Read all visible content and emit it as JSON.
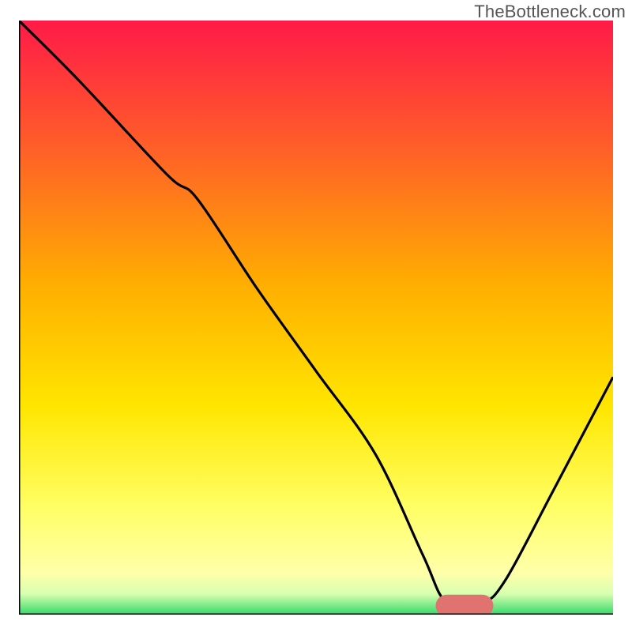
{
  "watermark": "TheBottleneck.com",
  "chart_data": {
    "type": "line",
    "title": "",
    "xlabel": "",
    "ylabel": "",
    "xlim": [
      0,
      100
    ],
    "ylim": [
      0,
      100
    ],
    "grid": false,
    "legend": false,
    "gradient_stops": [
      {
        "offset": 0.0,
        "color": "#ff1a48"
      },
      {
        "offset": 0.2,
        "color": "#ff5a2a"
      },
      {
        "offset": 0.45,
        "color": "#ffb000"
      },
      {
        "offset": 0.65,
        "color": "#ffe600"
      },
      {
        "offset": 0.82,
        "color": "#ffff66"
      },
      {
        "offset": 0.93,
        "color": "#ffffaa"
      },
      {
        "offset": 0.965,
        "color": "#d8ffb0"
      },
      {
        "offset": 1.0,
        "color": "#35d96a"
      }
    ],
    "series": [
      {
        "name": "curve",
        "color": "#000000",
        "x": [
          0,
          10,
          25,
          30,
          40,
          50,
          60,
          68,
          72,
          78,
          82,
          90,
          100
        ],
        "y": [
          100,
          90,
          74,
          70,
          55,
          41,
          27,
          10,
          2,
          2,
          6,
          21,
          40
        ]
      }
    ],
    "marker": {
      "name": "optimal-marker",
      "x_start": 72,
      "x_end": 78,
      "y": 1.5,
      "color": "#e0736f",
      "thickness": 2.2
    },
    "frame": {
      "stroke": "#000000",
      "stroke_width": 3,
      "sides": [
        "left",
        "bottom"
      ]
    }
  }
}
